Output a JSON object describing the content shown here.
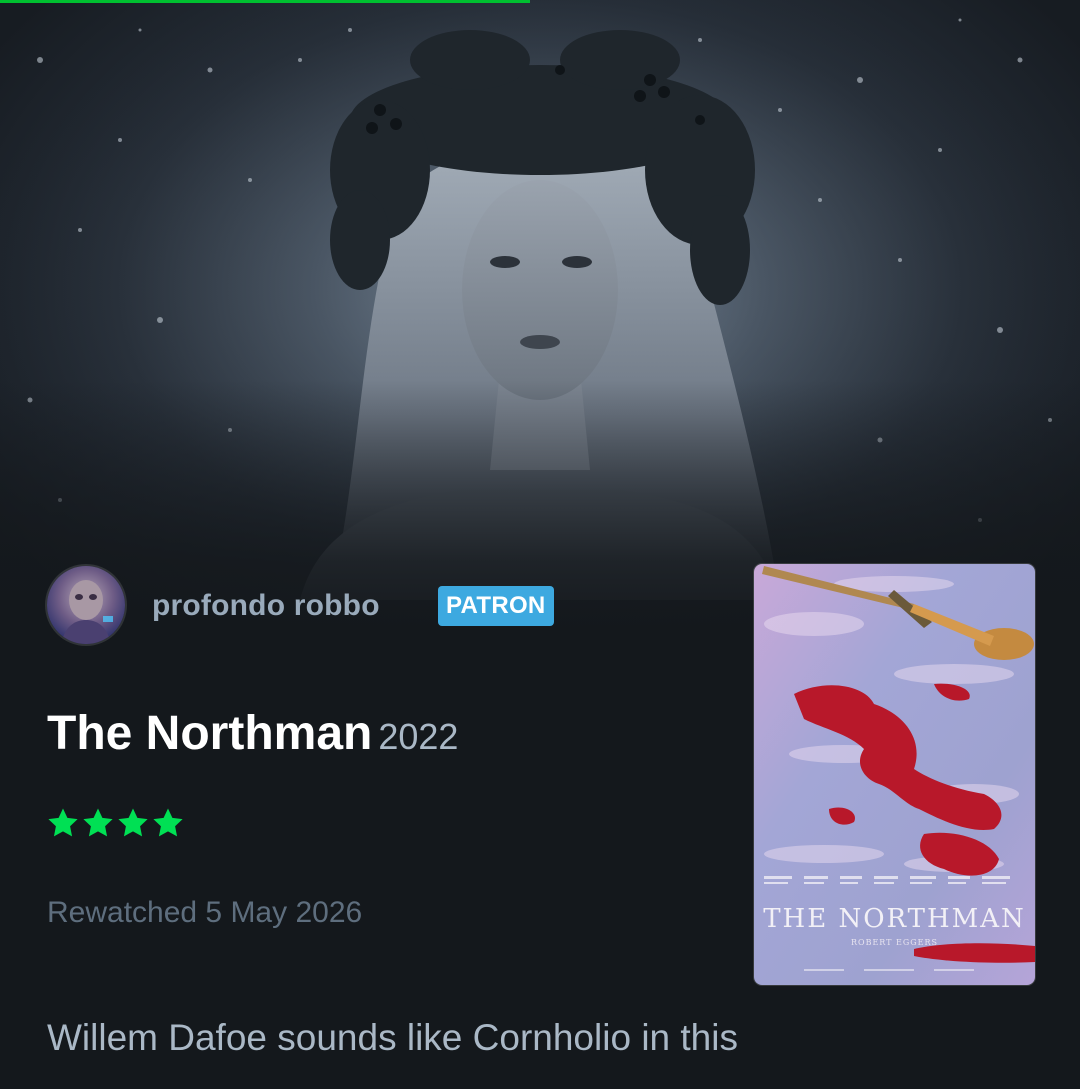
{
  "review": {
    "username": "profondo robbo",
    "badge": "PATRON",
    "film_title": "The Northman",
    "film_year": "2022",
    "rating_stars": 4,
    "watched_label": "Rewatched 5 May 2026",
    "text": "Willem Dafoe sounds like Cornholio in this"
  },
  "poster": {
    "title": "THE NORTHMAN",
    "director": "ROBERT EGGERS"
  },
  "colors": {
    "accent_green": "#00e054",
    "badge_blue": "#3da9e0",
    "background": "#14181c"
  },
  "icons": {
    "star": "star-icon"
  }
}
